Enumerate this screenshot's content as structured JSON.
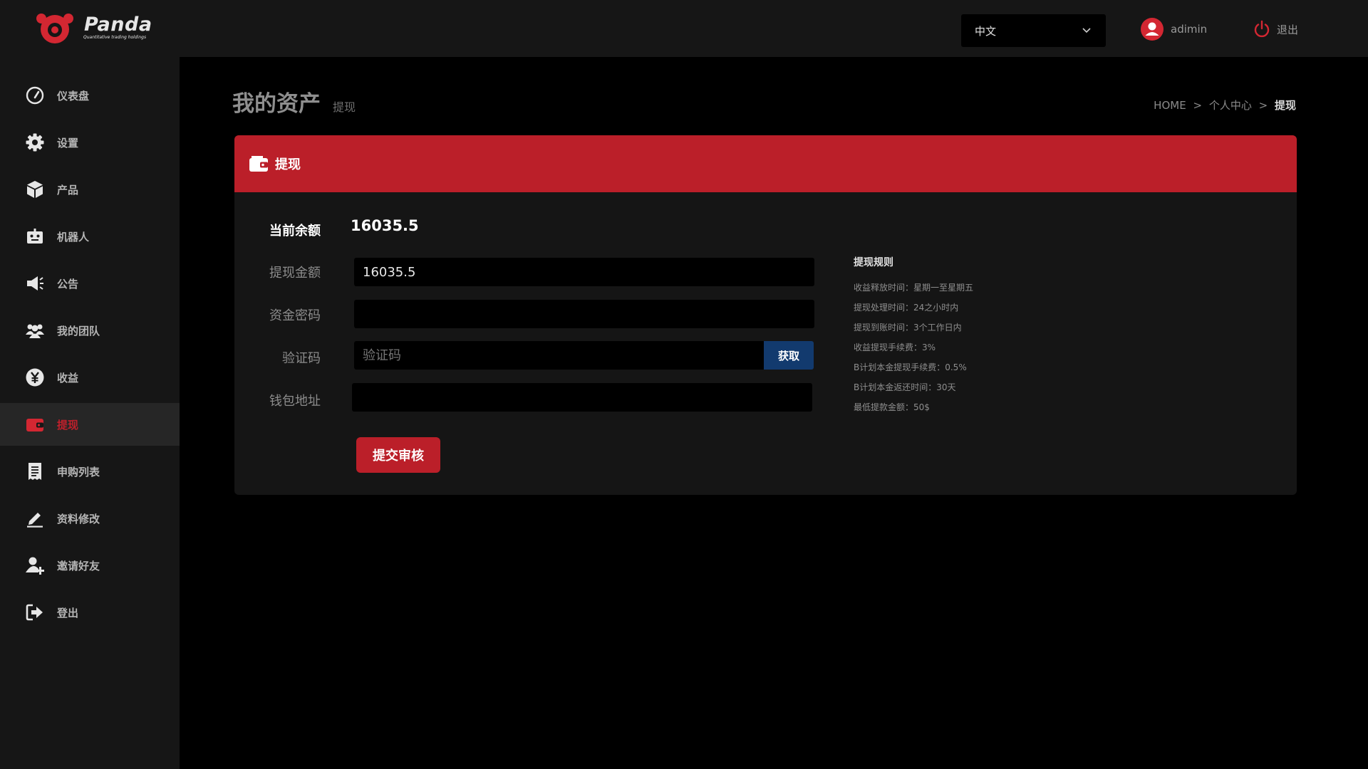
{
  "header": {
    "logo_text": "Panda",
    "logo_subtext": "Quantitative trading holdings",
    "language": "中文",
    "username": "adimin",
    "logout_label": "退出"
  },
  "sidebar": {
    "items": [
      {
        "label": "仪表盘",
        "icon": "dashboard-icon"
      },
      {
        "label": "设置",
        "icon": "gear-icon"
      },
      {
        "label": "产品",
        "icon": "box-icon"
      },
      {
        "label": "机器人",
        "icon": "robot-icon"
      },
      {
        "label": "公告",
        "icon": "megaphone-icon"
      },
      {
        "label": "我的团队",
        "icon": "team-icon"
      },
      {
        "label": "收益",
        "icon": "yen-icon"
      },
      {
        "label": "提现",
        "icon": "wallet-icon",
        "active": true
      },
      {
        "label": "申购列表",
        "icon": "receipt-icon"
      },
      {
        "label": "资料修改",
        "icon": "edit-icon"
      },
      {
        "label": "邀请好友",
        "icon": "add-user-icon"
      },
      {
        "label": "登出",
        "icon": "sign-out-icon"
      }
    ]
  },
  "page": {
    "title": "我的资产",
    "subtitle": "提现",
    "breadcrumb": [
      "HOME",
      "个人中心",
      "提现"
    ],
    "breadcrumb_sep": ">"
  },
  "card": {
    "title": "提现",
    "balance_label": "当前余额",
    "balance_value": "16035.5",
    "amount_label": "提现金额",
    "amount_value": "16035.5",
    "password_label": "资金密码",
    "password_value": "",
    "code_label": "验证码",
    "code_placeholder": "验证码",
    "get_code_label": "获取",
    "wallet_label": "钱包地址",
    "wallet_value": "",
    "submit_label": "提交审核"
  },
  "rules": {
    "title": "提现规则",
    "items": [
      "收益释放时间：星期一至星期五",
      "提现处理时间：24之小时内",
      "提现到账时间：3个工作日内",
      "收益提现手续费：3%",
      "B计划本金提现手续费：0.5%",
      "B计划本金返还时间：30天",
      "最低提款金额：50$"
    ]
  },
  "colors": {
    "accent": "#bb1f29",
    "get_button": "#123a6e",
    "sidebar_bg": "#161616",
    "page_bg": "#000000"
  }
}
